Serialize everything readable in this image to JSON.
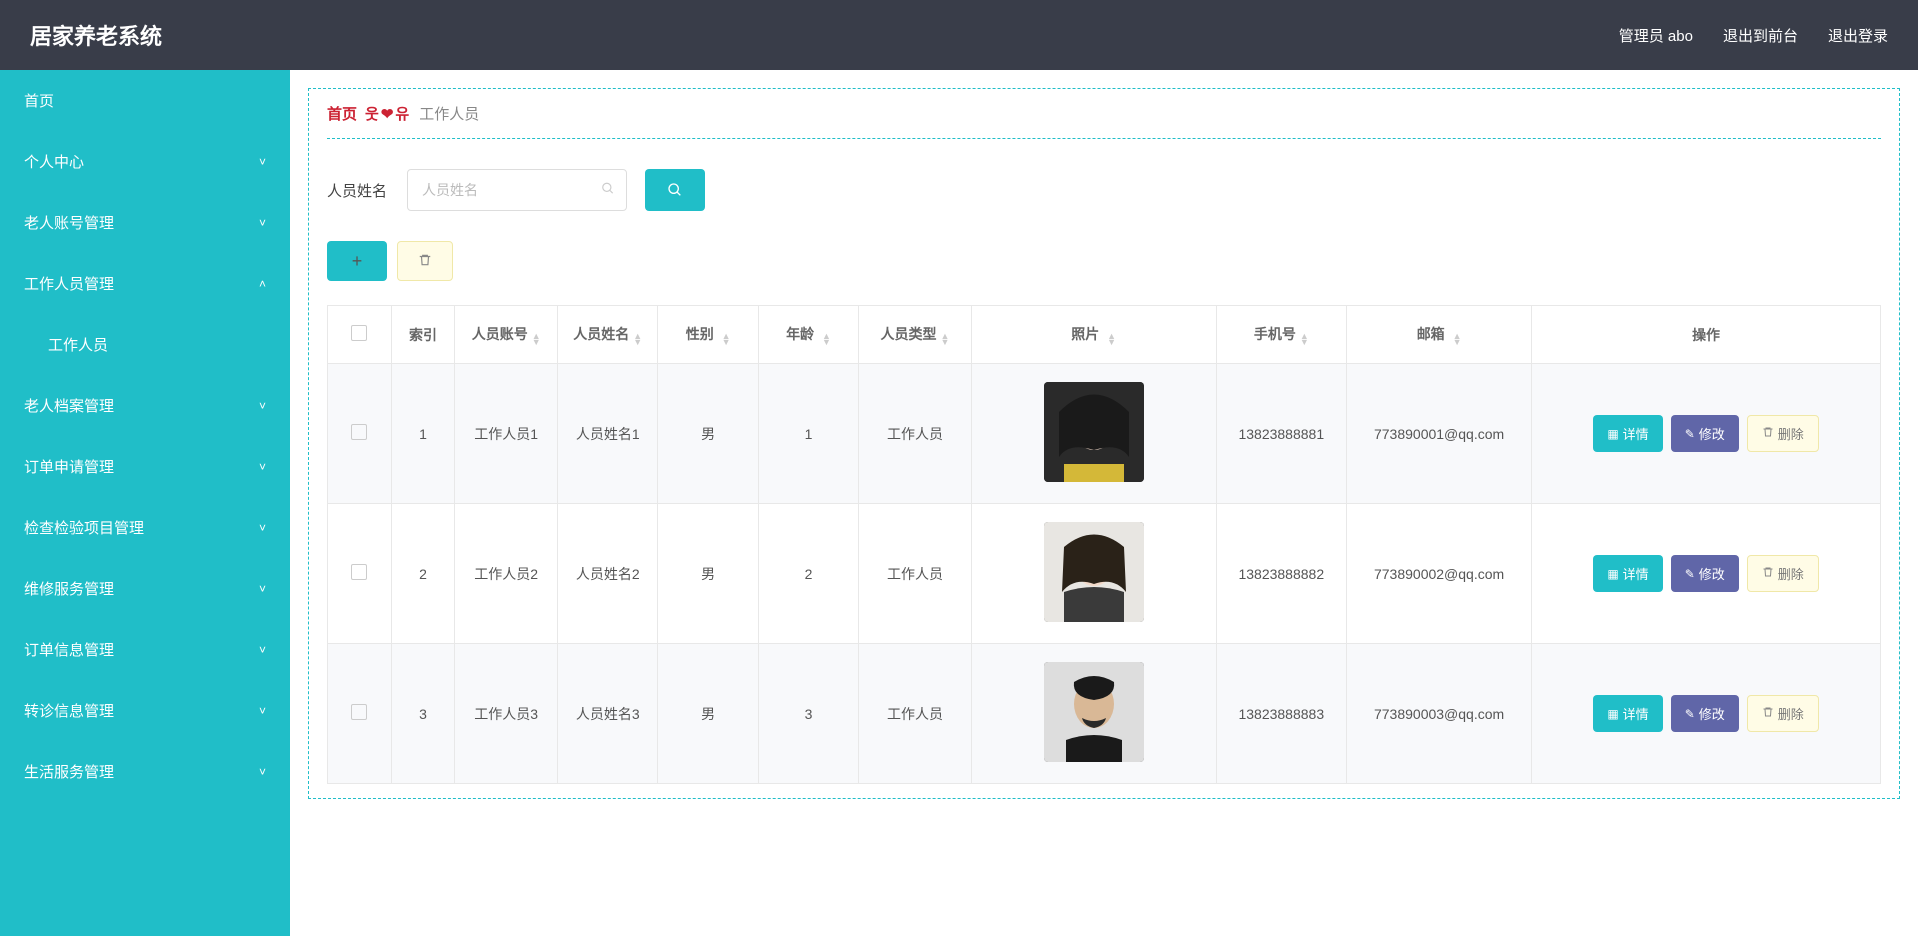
{
  "header": {
    "title": "居家养老系统",
    "admin_label": "管理员 abo",
    "to_front_label": "退出到前台",
    "logout_label": "退出登录"
  },
  "sidebar": {
    "items": [
      {
        "label": "首页",
        "expandable": false,
        "open": false
      },
      {
        "label": "个人中心",
        "expandable": true,
        "open": false
      },
      {
        "label": "老人账号管理",
        "expandable": true,
        "open": false
      },
      {
        "label": "工作人员管理",
        "expandable": true,
        "open": true
      },
      {
        "label": "老人档案管理",
        "expandable": true,
        "open": false
      },
      {
        "label": "订单申请管理",
        "expandable": true,
        "open": false
      },
      {
        "label": "检查检验项目管理",
        "expandable": true,
        "open": false
      },
      {
        "label": "维修服务管理",
        "expandable": true,
        "open": false
      },
      {
        "label": "订单信息管理",
        "expandable": true,
        "open": false
      },
      {
        "label": "转诊信息管理",
        "expandable": true,
        "open": false
      },
      {
        "label": "生活服务管理",
        "expandable": true,
        "open": false
      }
    ],
    "sub_item_label": "工作人员"
  },
  "breadcrumb": {
    "home": "首页",
    "separator": "웃❤유",
    "current": "工作人员"
  },
  "search": {
    "label": "人员姓名",
    "placeholder": "人员姓名"
  },
  "table": {
    "headers": {
      "index": "索引",
      "account": "人员账号",
      "name": "人员姓名",
      "gender": "性别",
      "age": "年龄",
      "type": "人员类型",
      "photo": "照片",
      "phone": "手机号",
      "email": "邮箱",
      "operations": "操作"
    },
    "op_labels": {
      "detail": "详情",
      "edit": "修改",
      "delete": "删除"
    },
    "rows": [
      {
        "index": "1",
        "account": "工作人员1",
        "name": "人员姓名1",
        "gender": "男",
        "age": "1",
        "type": "工作人员",
        "phone": "13823888881",
        "email": "773890001@qq.com"
      },
      {
        "index": "2",
        "account": "工作人员2",
        "name": "人员姓名2",
        "gender": "男",
        "age": "2",
        "type": "工作人员",
        "phone": "13823888882",
        "email": "773890002@qq.com"
      },
      {
        "index": "3",
        "account": "工作人员3",
        "name": "人员姓名3",
        "gender": "男",
        "age": "3",
        "type": "工作人员",
        "phone": "13823888883",
        "email": "773890003@qq.com"
      }
    ]
  }
}
